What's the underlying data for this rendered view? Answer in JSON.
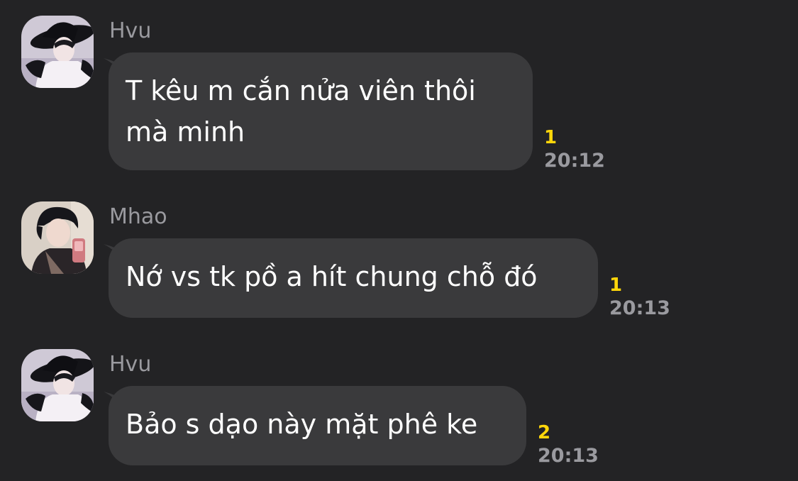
{
  "messages": [
    {
      "sender": "Hvu",
      "text_lines": [
        "T kêu m cắn nửa viên thôi",
        "mà minh"
      ],
      "unread": "1",
      "time": "20:12",
      "avatar": "avatar-hvu"
    },
    {
      "sender": "Mhao",
      "text_lines": [
        "Nớ vs tk pồ a hít chung chỗ đó"
      ],
      "unread": "1",
      "time": "20:13",
      "avatar": "avatar-mhao"
    },
    {
      "sender": "Hvu",
      "text_lines": [
        "Bảo s dạo này mặt phê ke"
      ],
      "unread": "2",
      "time": "20:13",
      "avatar": "avatar-hvu"
    }
  ],
  "colors": {
    "background": "#232325",
    "bubble": "#3a3a3c",
    "sender_name": "#9a9a9f",
    "unread_count": "#ffd60a",
    "timestamp": "#9a9a9f"
  }
}
